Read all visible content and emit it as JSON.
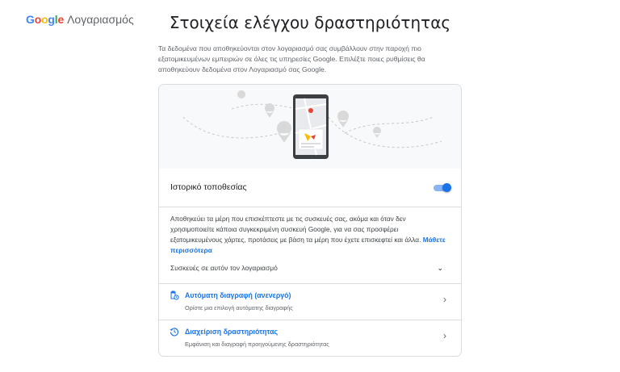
{
  "header": {
    "logo_google": "Google",
    "logo_account": "Λογαριασμός",
    "title": "Στοιχεία ελέγχου δραστηριότητας"
  },
  "intro": "Τα δεδομένα που αποθηκεύονται στον λογαριασμό σας συμβάλλουν στην παροχή πιο εξατομικευμένων εμπειριών σε όλες τις υπηρεσίες Google. Επιλέξτε ποιες ρυθμίσεις θα αποθηκεύουν δεδομένα στον Λογαριασμό σας Google.",
  "card": {
    "setting_label": "Ιστορικό τοποθεσίας",
    "toggle_on": true,
    "description": "Αποθηκεύει τα μέρη που επισκέπτεστε με τις συσκευές σας, ακόμα και όταν δεν χρησιμοποιείτε κάποια συγκεκριμένη συσκευή Google, για να σας προσφέρει εξατομικευμένους χάρτες, προτάσεις με βάση τα μέρη που έχετε επισκεφτεί και άλλα.",
    "learn_more": "Μάθετε περισσότερα",
    "devices_label": "Συσκευές σε αυτόν τον λογαριασμό",
    "auto_delete": {
      "title": "Αυτόματη διαγραφή (ανενεργό)",
      "subtitle": "Ορίστε μια επιλογή αυτόματης διαγραφής"
    },
    "manage": {
      "title": "Διαχείριση δραστηριότητας",
      "subtitle": "Εμφάνιση και διαγραφή προηγούμενης δραστηριότητας"
    }
  },
  "colors": {
    "accent": "#1a73e8",
    "toggle_track": "#8ab4f8",
    "border": "#dadce0",
    "google_blue": "#4285f4",
    "google_red": "#ea4335",
    "google_yellow": "#fbbc05",
    "google_green": "#34a853"
  },
  "icons": {
    "auto_delete": "auto-delete-icon",
    "manage": "history-icon",
    "devices_chevron": "chevron-down-icon",
    "row_arrow": "chevron-right-icon"
  }
}
